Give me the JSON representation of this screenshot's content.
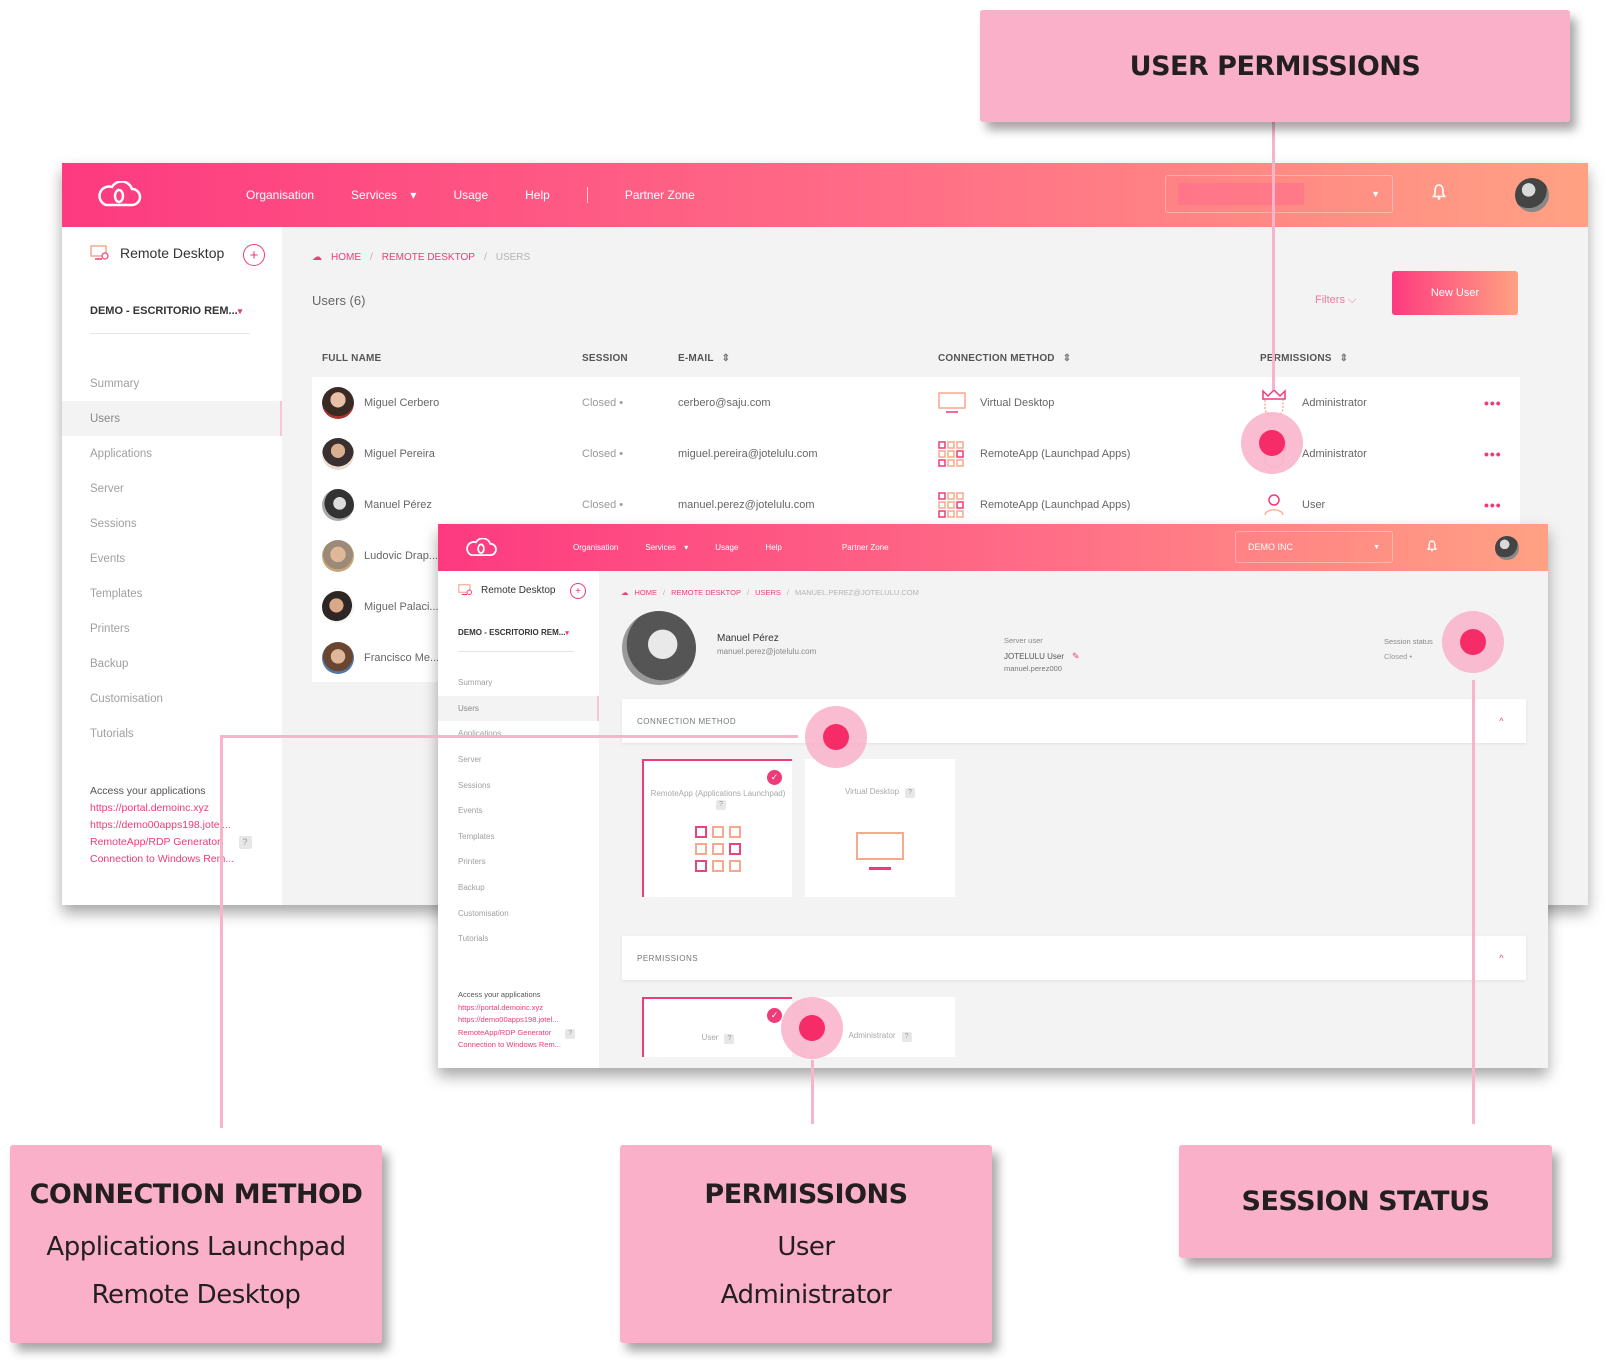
{
  "callouts": {
    "user_permissions": {
      "title": "USER PERMISSIONS"
    },
    "connection_method": {
      "title": "CONNECTION METHOD",
      "lines": [
        "Applications Launchpad",
        "Remote Desktop"
      ]
    },
    "permissions": {
      "title": "PERMISSIONS",
      "lines": [
        "User",
        "Administrator"
      ]
    },
    "session_status": {
      "title": "SESSION STATUS"
    }
  },
  "colors": {
    "accent": "#ef3b77",
    "gradient_start": "#fd3a80",
    "gradient_end": "#ffa183",
    "callout_bg": "#f9b0c8",
    "hotspot": "#f52c68"
  },
  "topnav": {
    "items": [
      "Organisation",
      "Services",
      "Usage",
      "Help",
      "Partner Zone"
    ],
    "services_caret": "▾",
    "org_select_value": "DEMO INC",
    "bell_icon": "🔔"
  },
  "sidebar": {
    "service_title": "Remote Desktop",
    "add_icon": "+",
    "project": "DEMO - ESCRITORIO REM...",
    "project_caret": "▾",
    "items": [
      "Summary",
      "Users",
      "Applications",
      "Server",
      "Sessions",
      "Events",
      "Templates",
      "Printers",
      "Backup",
      "Customisation",
      "Tutorials"
    ],
    "active_item": "Users",
    "access_title": "Access your applications",
    "links": [
      "https://portal.demoinc.xyz",
      "https://demo00apps198.jotel...",
      "RemoteApp/RDP Generator",
      "Connection to Windows Rem..."
    ],
    "help_icon": "?"
  },
  "users_page": {
    "breadcrumb": [
      "HOME",
      "REMOTE DESKTOP",
      "USERS"
    ],
    "title": "Users (6)",
    "filters_label": "Filters ⌵",
    "new_user_label": "New User",
    "columns": [
      "FULL NAME",
      "SESSION",
      "E-MAIL",
      "CONNECTION METHOD",
      "PERMISSIONS"
    ],
    "sort_icon": "⇕",
    "rows": [
      {
        "name": "Miguel Cerbero",
        "session": "Closed •",
        "email": "cerbero@saju.com",
        "connection": "Virtual Desktop",
        "connection_icon": "monitor",
        "permission": "Administrator",
        "permission_icon": "crown"
      },
      {
        "name": "Miguel Pereira",
        "session": "Closed •",
        "email": "miguel.pereira@jotelulu.com",
        "connection": "RemoteApp (Launchpad Apps)",
        "connection_icon": "grid",
        "permission": "Administrator",
        "permission_icon": "crown"
      },
      {
        "name": "Manuel Pérez",
        "session": "Closed •",
        "email": "manuel.perez@jotelulu.com",
        "connection": "RemoteApp (Launchpad Apps)",
        "connection_icon": "grid",
        "permission": "User",
        "permission_icon": "user"
      },
      {
        "name": "Ludovic Drap...",
        "session": "",
        "email": "",
        "connection": "",
        "permission": ""
      },
      {
        "name": "Miguel Palaci...",
        "session": "",
        "email": "",
        "connection": "",
        "permission": ""
      },
      {
        "name": "Francisco Me...",
        "session": "",
        "email": "",
        "connection": "",
        "permission": ""
      }
    ],
    "more_icon": "•••"
  },
  "user_detail": {
    "breadcrumb": [
      "HOME",
      "REMOTE DESKTOP",
      "USERS",
      "MANUEL.PEREZ@JOTELULU.COM"
    ],
    "name": "Manuel Pérez",
    "email": "manuel.perez@jotelulu.com",
    "server_user_label": "Server user",
    "server_user_value": "JOTELULU User",
    "server_login": "manuel.perez000",
    "session_status_label": "Session status",
    "session_status_value": "Closed •",
    "connection_section": "CONNECTION METHOD",
    "connection_options": [
      {
        "label": "RemoteApp (Applications Launchpad)",
        "selected": true
      },
      {
        "label": "Virtual Desktop",
        "selected": false
      }
    ],
    "permissions_section": "PERMISSIONS",
    "permission_options": [
      {
        "label": "User",
        "selected": true
      },
      {
        "label": "Administrator",
        "selected": false
      }
    ],
    "collapse_icon": "^",
    "check_icon": "✓"
  }
}
